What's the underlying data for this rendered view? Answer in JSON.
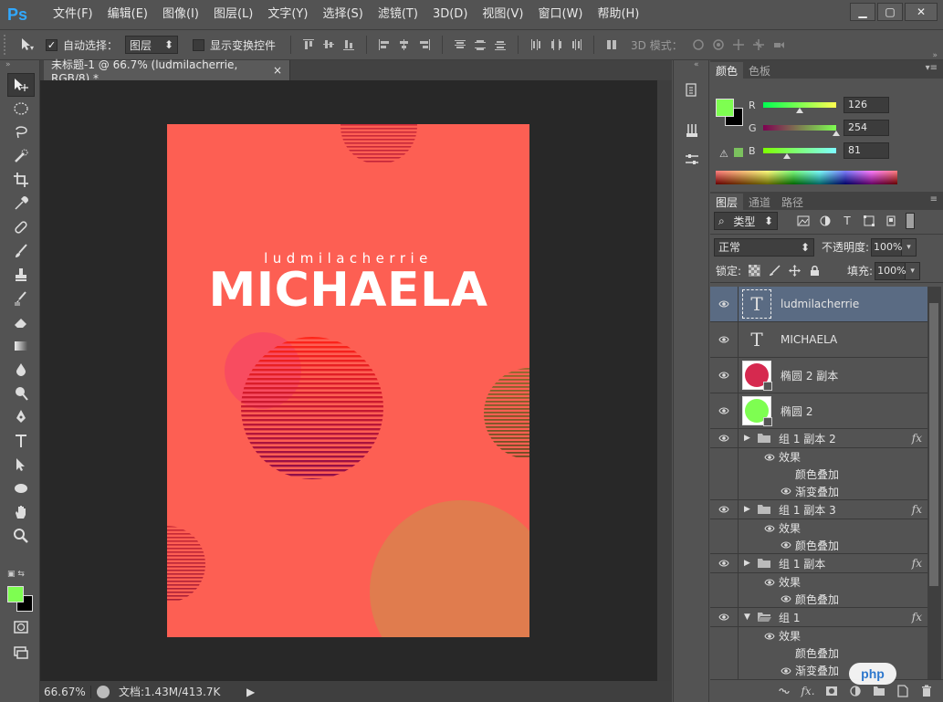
{
  "menubar": {
    "logo": "Ps",
    "items": [
      "文件(F)",
      "编辑(E)",
      "图像(I)",
      "图层(L)",
      "文字(Y)",
      "选择(S)",
      "滤镜(T)",
      "3D(D)",
      "视图(V)",
      "窗口(W)",
      "帮助(H)"
    ],
    "minimize": "▁",
    "maximize": "▢",
    "close": "✕"
  },
  "options": {
    "auto_select_label": "自动选择：",
    "auto_select_value": "图层",
    "show_transform_label": "显示变换控件",
    "mode3d_label": "3D 模式："
  },
  "document": {
    "tab_title": "未标题-1 @ 66.7% (ludmilacherrie, RGB/8) *",
    "tab_close": "×",
    "zoom": "66.67%",
    "doc_info": "文档:1.43M/413.7K"
  },
  "artwork": {
    "subtitle": "ludmilacherrie",
    "title": "MICHAELA",
    "background_color": "#fd5f53"
  },
  "color_panel": {
    "tabs": [
      "颜色",
      "色板"
    ],
    "fg_color": "#7efe51",
    "bg_color": "#000000",
    "r_label": "R",
    "g_label": "G",
    "b_label": "B",
    "r_value": "126",
    "g_value": "254",
    "b_value": "81"
  },
  "layers_panel": {
    "tabs": [
      "图层",
      "通道",
      "路径"
    ],
    "filter_type": "类型",
    "blend_mode": "正常",
    "opacity_label": "不透明度:",
    "opacity_value": "100%",
    "lock_label": "锁定:",
    "fill_label": "填充:",
    "fill_value": "100%",
    "layers": [
      {
        "name": "ludmilacherrie",
        "kind": "text",
        "selected": true
      },
      {
        "name": "MICHAELA",
        "kind": "text"
      },
      {
        "name": "椭圆 2 副本",
        "kind": "shape",
        "color": "#d6294f"
      },
      {
        "name": "椭圆 2",
        "kind": "shape",
        "color": "#7efe51"
      }
    ],
    "groups": [
      {
        "name": "组 1 副本 2",
        "effects_label": "效果",
        "effects": [
          "颜色叠加",
          "渐变叠加"
        ]
      },
      {
        "name": "组 1 副本 3",
        "effects_label": "效果",
        "effects": [
          "颜色叠加"
        ]
      },
      {
        "name": "组 1 副本",
        "effects_label": "效果",
        "effects": [
          "颜色叠加"
        ]
      },
      {
        "name": "组 1",
        "effects_label": "效果",
        "effects": [
          "颜色叠加",
          "渐变叠加"
        ]
      }
    ],
    "fx_label": "fx"
  },
  "watermark": "php"
}
